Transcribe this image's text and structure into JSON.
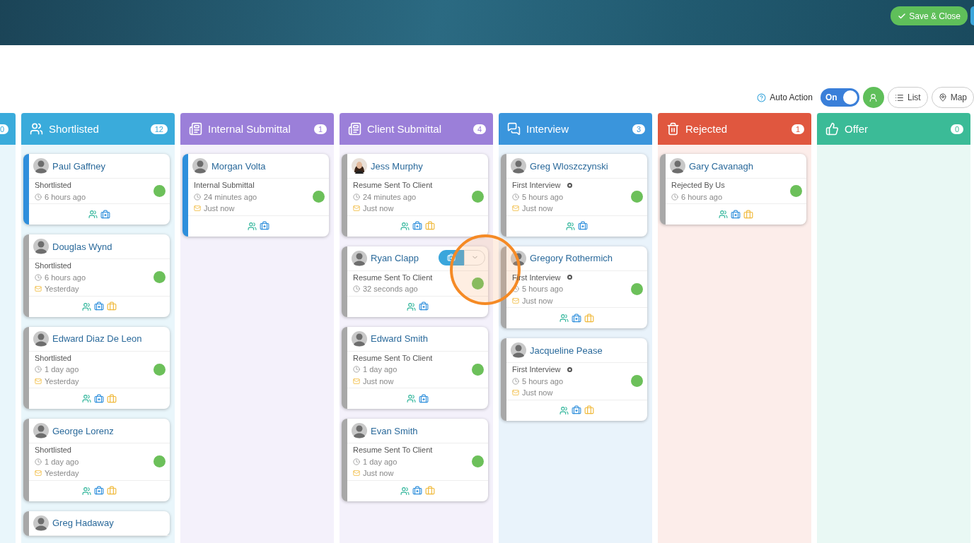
{
  "header": {
    "save_button": "Save & Close"
  },
  "toolbar": {
    "auto_action_label": "Auto Action",
    "toggle": {
      "label": "On",
      "on": true
    },
    "list_button": "List",
    "map_button": "Map"
  },
  "cursor_highlight": true,
  "columns": [
    {
      "kind": "partial",
      "count": "0",
      "color": "#3aabdb"
    },
    {
      "kind": "full",
      "title": "Shortlisted",
      "count": "12",
      "color": "#3aabdb",
      "cards": [
        {
          "name": "Paul Gaffney",
          "photo": false,
          "highlighted": true,
          "status": "Shortlisted",
          "time": "6 hours ago",
          "suitcase": false
        },
        {
          "name": "Douglas Wynd",
          "photo": false,
          "highlighted": false,
          "status": "Shortlisted",
          "time": "6 hours ago",
          "email": "Yesterday",
          "suitcase": true
        },
        {
          "name": "Edward Diaz De Leon",
          "photo": false,
          "highlighted": false,
          "status": "Shortlisted",
          "time": "1 day ago",
          "email": "Yesterday",
          "suitcase": true
        },
        {
          "name": "George Lorenz",
          "photo": false,
          "highlighted": false,
          "status": "Shortlisted",
          "time": "1 day ago",
          "email": "Yesterday",
          "suitcase": true
        },
        {
          "name": "Greg Hadaway",
          "photo": false,
          "highlighted": false
        }
      ]
    },
    {
      "kind": "full",
      "title": "Internal Submittal",
      "count": "1",
      "color": "#9b7fd9",
      "cards": [
        {
          "name": "Morgan Volta",
          "photo": false,
          "highlighted": true,
          "status": "Internal Submittal",
          "time": "24 minutes ago",
          "email": "Just now",
          "suitcase": false
        }
      ]
    },
    {
      "kind": "full",
      "title": "Client Submittal",
      "count": "4",
      "color": "#9b7fd9",
      "cards": [
        {
          "name": "Jess Murphy",
          "photo": true,
          "highlighted": false,
          "status": "Resume Sent To Client",
          "time": "24 minutes ago",
          "email": "Just now",
          "suitcase": true
        },
        {
          "name": "Ryan Clapp",
          "photo": false,
          "highlighted": false,
          "status": "Resume Sent To Client",
          "time": "32 seconds ago",
          "suitcase": false,
          "hover": true
        },
        {
          "name": "Edward Smith",
          "photo": false,
          "highlighted": false,
          "status": "Resume Sent To Client",
          "time": "1 day ago",
          "email": "Just now",
          "suitcase": false
        },
        {
          "name": "Evan Smith",
          "photo": false,
          "highlighted": false,
          "status": "Resume Sent To Client",
          "time": "1 day ago",
          "email": "Just now",
          "suitcase": true
        }
      ]
    },
    {
      "kind": "full",
      "title": "Interview",
      "count": "3",
      "color": "#3a95dc",
      "cards": [
        {
          "name": "Greg Wloszczynski",
          "photo": false,
          "highlighted": false,
          "status": "First Interview",
          "marker": true,
          "time": "5 hours ago",
          "email": "Just now",
          "suitcase": false
        },
        {
          "name": "Gregory Rothermich",
          "photo": false,
          "highlighted": false,
          "status": "First Interview",
          "marker": true,
          "time": "5 hours ago",
          "email": "Just now",
          "suitcase": true
        },
        {
          "name": "Jacqueline Pease",
          "photo": false,
          "highlighted": false,
          "status": "First Interview",
          "marker": true,
          "time": "5 hours ago",
          "email": "Just now",
          "suitcase": true
        }
      ]
    },
    {
      "kind": "full",
      "title": "Rejected",
      "count": "1",
      "color": "#e0573f",
      "cards": [
        {
          "name": "Gary Cavanagh",
          "photo": false,
          "highlighted": false,
          "status": "Rejected By Us",
          "time": "6 hours ago",
          "suitcase": true
        }
      ]
    },
    {
      "kind": "full",
      "title": "Offer",
      "count": "0",
      "color": "#3bbb97"
    }
  ]
}
